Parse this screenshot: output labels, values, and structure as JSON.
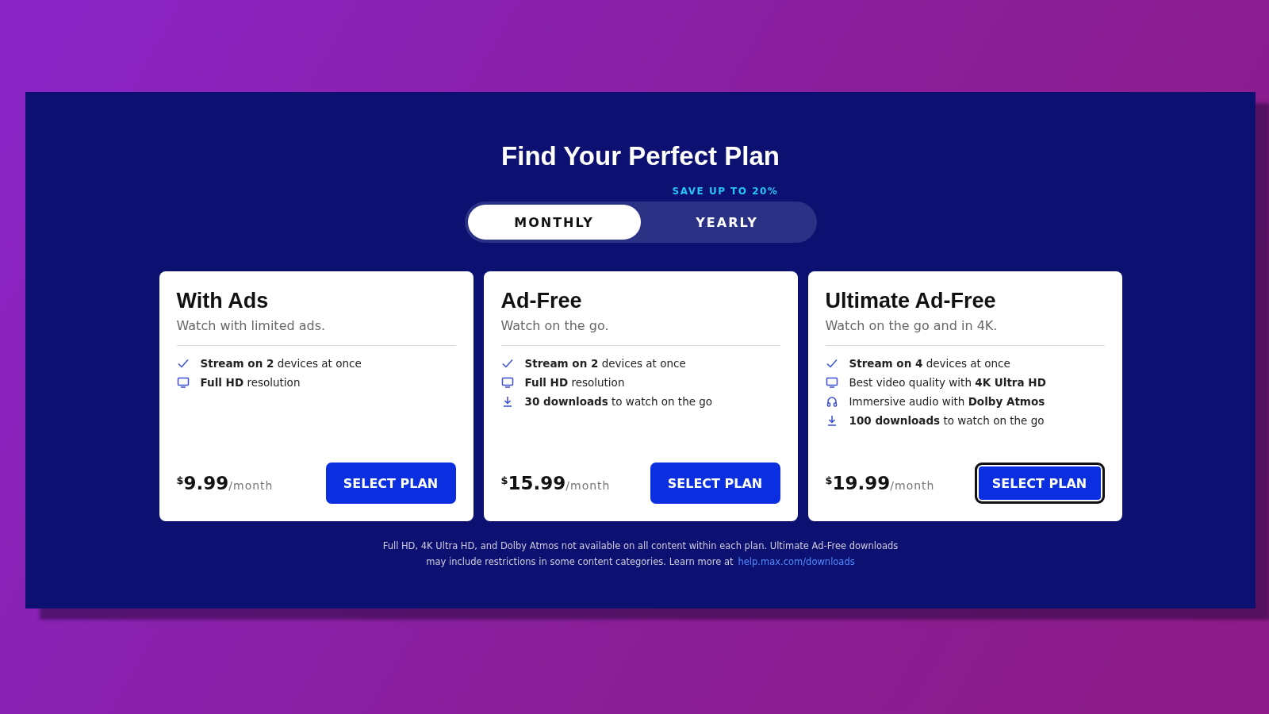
{
  "title": "Find Your Perfect Plan",
  "billing": {
    "promo": "SAVE UP TO 20%",
    "options": [
      {
        "label": "MONTHLY",
        "selected": true
      },
      {
        "label": "YEARLY",
        "selected": false
      }
    ]
  },
  "plans": [
    {
      "name": "With Ads",
      "tagline": "Watch with limited ads.",
      "features": [
        {
          "kind": "check",
          "text": "**Stream on 2** devices at once"
        },
        {
          "kind": "screen",
          "text": "**Full HD** resolution"
        }
      ],
      "currency": "$",
      "price": "9.99",
      "period": "/month",
      "button": "SELECT PLAN",
      "focused": false
    },
    {
      "name": "Ad-Free",
      "tagline": "Watch on the go.",
      "features": [
        {
          "kind": "check",
          "text": "**Stream on 2** devices at once"
        },
        {
          "kind": "screen",
          "text": "**Full HD** resolution"
        },
        {
          "kind": "download",
          "text": "**30 downloads** to watch on the go"
        }
      ],
      "currency": "$",
      "price": "15.99",
      "period": "/month",
      "button": "SELECT PLAN",
      "focused": false
    },
    {
      "name": "Ultimate Ad-Free",
      "tagline": "Watch on the go and in 4K.",
      "features": [
        {
          "kind": "check",
          "text": "**Stream on 4** devices at once"
        },
        {
          "kind": "screen",
          "text": "Best video quality with **4K Ultra HD**"
        },
        {
          "kind": "audio",
          "text": "Immersive audio with **Dolby Atmos**"
        },
        {
          "kind": "download",
          "text": "**100 downloads** to watch on the go"
        }
      ],
      "currency": "$",
      "price": "19.99",
      "period": "/month",
      "button": "SELECT PLAN",
      "focused": true
    }
  ],
  "footnote": {
    "line_1": "Full HD, 4K Ultra HD, and Dolby Atmos not available on all content within each plan. Ultimate Ad-Free downloads",
    "line_2": "may include restrictions in some content categories. Learn more at",
    "link": "help.max.com/downloads"
  }
}
